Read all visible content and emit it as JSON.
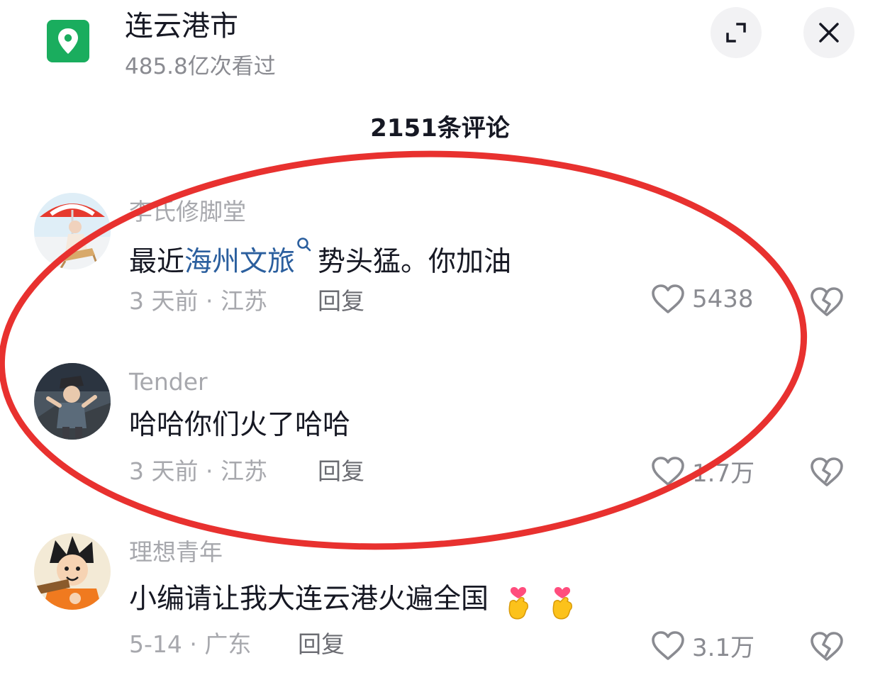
{
  "location": {
    "title": "连云港市",
    "views": "485.8亿次看过"
  },
  "comments_header": "2151条评论",
  "comments": [
    {
      "username": "李氏修脚堂",
      "text_before": "最近",
      "text_link": "海州文旅",
      "text_after": "势头猛。你加油",
      "time_location": "3 天前 · 江苏",
      "reply": "回复",
      "likes": "5438"
    },
    {
      "username": "Tender",
      "text": "哈哈你们火了哈哈",
      "time_location": "3 天前 · 江苏",
      "reply": "回复",
      "likes": "1.7万"
    },
    {
      "username": "理想青年",
      "text": "小编请让我大连云港火遍全国",
      "time_location": "5-14 · 广东",
      "reply": "回复",
      "likes": "3.1万"
    }
  ],
  "colors": {
    "location_icon": "#1aad5e",
    "link": "#2b5f9e",
    "annotation_ellipse": "#e8312f"
  }
}
